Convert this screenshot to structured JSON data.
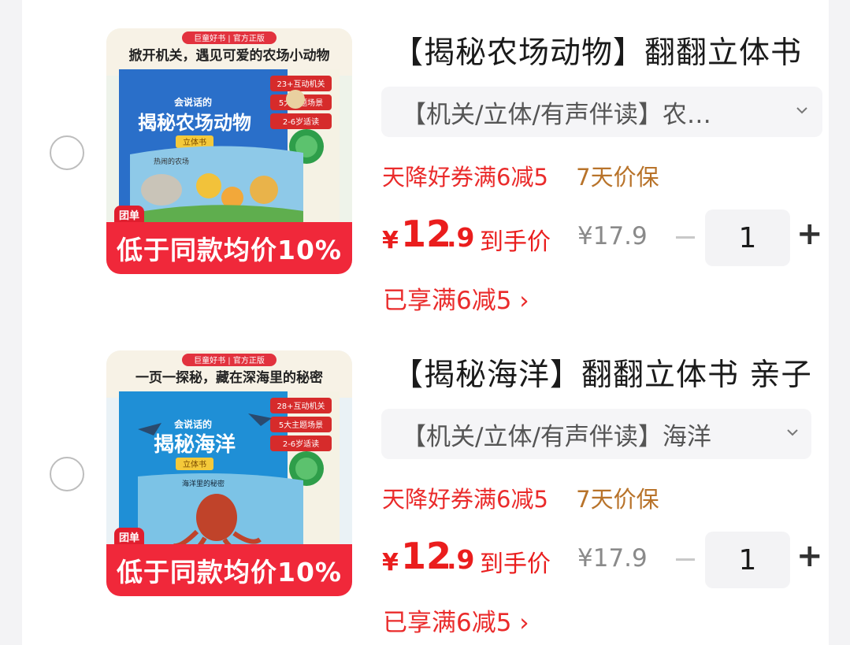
{
  "products": [
    {
      "title": "【揭秘农场动物】翻翻立体书 亲子",
      "spec": "【机关/立体/有声伴读】农…",
      "coupon": "天降好券满6减5",
      "price_guarantee": "7天价保",
      "price_currency": "¥",
      "price_int": "12",
      "price_dec": ".9",
      "price_label": "到手价",
      "original_price": "¥17.9",
      "quantity": "1",
      "discount_applied": "已享满6减5 ›",
      "image": {
        "promo_text": "低于同款均价10%",
        "corner_tag": "团单",
        "top_badge": "巨童好书 | 官方正版",
        "headline": "掀开机关，遇见可爱的农场小动物",
        "series": "会说话的",
        "book_title": "揭秘农场动物",
        "book_type": "立体书",
        "features": [
          "23+互动机关",
          "5大主题场景",
          "2-6岁适读"
        ],
        "scene_label": "热闹的农场",
        "bg_color": "#2a6fc9",
        "accent_color": "#f0283a"
      }
    },
    {
      "title": "【揭秘海洋】翻翻立体书 亲子",
      "spec": "【机关/立体/有声伴读】海洋",
      "coupon": "天降好券满6减5",
      "price_guarantee": "7天价保",
      "price_currency": "¥",
      "price_int": "12",
      "price_dec": ".9",
      "price_label": "到手价",
      "original_price": "¥17.9",
      "quantity": "1",
      "discount_applied": "已享满6减5 ›",
      "image": {
        "promo_text": "低于同款均价10%",
        "corner_tag": "团单",
        "top_badge": "巨童好书 | 官方正版",
        "headline": "一页一探秘，藏在深海里的秘密",
        "series": "会说话的",
        "book_title": "揭秘海洋",
        "book_type": "立体书",
        "features": [
          "28+互动机关",
          "5大主题场景",
          "2-6岁适读"
        ],
        "scene_label": "海洋里的秘密",
        "bg_color": "#1f8fd6",
        "accent_color": "#f0283a"
      }
    }
  ],
  "icons": {
    "radio": "radio-unchecked-icon",
    "spec_dropdown": "chevron-down-icon",
    "minus": "minus-icon",
    "plus": "plus-icon"
  }
}
